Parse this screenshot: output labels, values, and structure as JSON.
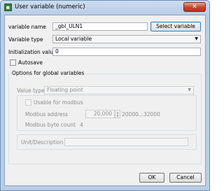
{
  "window": {
    "title": "User variable (numeric)",
    "icon": "app-icon",
    "close_glyph": "✕"
  },
  "form": {
    "variable_name_label": "variable name",
    "variable_name_value": "_gbl_ULN1",
    "select_variable_label": "Select variable",
    "variable_type_label": "Variable type",
    "variable_type_value": "Local variable",
    "init_value_label": "Initialization value",
    "init_value_value": "0",
    "autosave_label": "Autosave"
  },
  "global_options": {
    "title": "Options for global variables",
    "value_type_label": "Value type",
    "value_type_value": "Floating point",
    "usable_modbus_label": "Usable for modbus",
    "modbus_address_label": "Modbus address",
    "modbus_address_value": "20,000",
    "modbus_range": "20000...32000",
    "modbus_byte_count_label": "Modbus byte count",
    "modbus_byte_count_value": "4",
    "unit_label": "Unit/Description",
    "unit_value": ""
  },
  "buttons": {
    "ok": "OK",
    "cancel": "Cancel"
  }
}
